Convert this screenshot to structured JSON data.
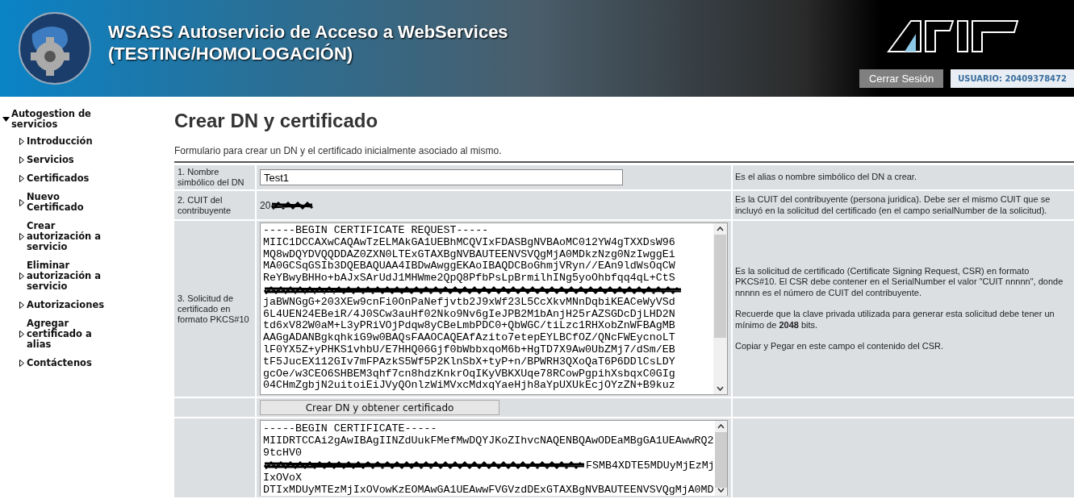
{
  "header": {
    "title_line_1": "WSASS Autoservicio de Acceso a WebServices",
    "title_line_2": "(TESTING/HOMOLOGACIÓN)",
    "logout_button": "Cerrar Sesión",
    "user_badge": "USUARIO: 20409378472"
  },
  "sidebar": {
    "group": {
      "label": "Autogestion de servicios",
      "expanded": true
    },
    "items": [
      {
        "label": "Introducción"
      },
      {
        "label": "Servicios"
      },
      {
        "label": "Certificados"
      },
      {
        "label": "Nuevo Certificado"
      },
      {
        "label": "Crear autorización a servicio"
      },
      {
        "label": "Eliminar autorización a servicio"
      },
      {
        "label": "Autorizaciones"
      },
      {
        "label": "Agregar certificado a alias"
      },
      {
        "label": "Contáctenos"
      }
    ]
  },
  "page": {
    "title": "Crear DN y certificado",
    "description": "Formulario para crear un DN y el certificado inicialmente asociado al mismo."
  },
  "form": {
    "rows": [
      {
        "kind": "input",
        "label": "1. Nombre simbólico del DN",
        "value": "Test1",
        "help": [
          "Es el alias o nombre simbólico del DN a crear."
        ]
      },
      {
        "kind": "redacted",
        "label": "2. CUIT del contribuyente",
        "value": "20",
        "help": [
          "Es la CUIT del contribuyente (persona juridica). Debe ser el mismo CUIT que se incluyó en la solicitud del certificado (en el campo serialNumber de la solicitud)."
        ]
      },
      {
        "kind": "textarea",
        "label": "3. Solicitud de certificado en formato PKCS#10",
        "lines": [
          {
            "kind": "text",
            "text": "-----BEGIN CERTIFICATE REQUEST-----"
          },
          {
            "kind": "text",
            "text": "MIIC1DCCAXwCAQAwTzELMAkGA1UEBhMCQVIxFDASBgNVBAoMC012YW4gTXXDsW96"
          },
          {
            "kind": "text",
            "text": "MQ8wDQYDVQQDDAZ0ZXN0LTExGTAXBgNVBAUTEENVSVQgMjA0MDkzNzg0NzIwggEi"
          },
          {
            "kind": "text",
            "text": "MA0GCSqGSIb3DQEBAQUAA4IBDwAwggEKAoIBAQDCBoGhmjVRyn//EAn9ldWsOqCW"
          },
          {
            "kind": "text",
            "text": "ReYBwyBHHo+bAJxSArUdJ1MHWme2QpQ8PfbPsLpBrmilhINg5yoOhbfqq4qL+CtS"
          },
          {
            "kind": "redacted"
          },
          {
            "kind": "text",
            "text": "jaBWNGgG+203XEw9cnFi0OnPaNefjvtb2J9xWf23L5CcXkvMNnDqbiKEACeWyVSd"
          },
          {
            "kind": "text",
            "text": "6L4UEN24EBeiR/4J0SCw3auHf02Nko9Nv6gIeJPB2M1bAnjH25rAZSGDcDjLHD2N"
          },
          {
            "kind": "text",
            "text": "td6xV82W0aM+L3yPRiVOjPdqw8yCBeLmbPDC0+QbWGC/tiLzc1RHXobZnWFBAgMB"
          },
          {
            "kind": "text",
            "text": "AAGgADANBgkqhkiG9w0BAQsFAAOCAQEAfAzito7etepEYLBCfOZ/QNcFWEycnoLT"
          },
          {
            "kind": "text",
            "text": "lF0YX5Z+yPHKS1vhbU/E7HHQ06Gjf0bWbbxqoM6b+HgTD7X9Aw0UbZMj7/dSm/EB"
          },
          {
            "kind": "text",
            "text": "tF5JucEX112GIv7mFPAzkS5Wf5P2KlnSbX+tyP+n/BPWRH3QXoQaT6P6DDlCsLDY"
          },
          {
            "kind": "text",
            "text": "gcOe/w3CEO6SHBEM3qhf7cn8hdzKnkrOqIKyVBKXUqe78RCowPgpihXsbqxC0GIg"
          },
          {
            "kind": "text",
            "text": "04CHmZgbjN2uitoiEiJVyQOnlzWiMVxcMdxqYaeHjh8aYpUXUkEcjOYzZN+B9kuz"
          }
        ],
        "help": [
          "Es la solicitud de certificado (Certificate Signing Request, CSR) en formato PKCS#10. El CSR debe contener en el SerialNumber el valor \"CUIT nnnnn\", donde nnnnn es el número de CUIT del contribuyente.",
          "Recuerde que la clave privada utilizada para generar esta solicitud debe tener un mínimo de **2048** bits.",
          "Copiar y Pegar en este campo el contenido del CSR."
        ]
      },
      {
        "kind": "button",
        "label_button": "Crear DN y obtener certificado"
      },
      {
        "kind": "output",
        "lines": [
          {
            "kind": "text",
            "text": "-----BEGIN CERTIFICATE-----"
          },
          {
            "kind": "text",
            "text": "MIIDRTCCAi2gAwIBAgIINZdUukFMefMwDQYJKoZIhvcNAQENBQAwODEaMBgGA1UEAwwRQ2"
          },
          {
            "kind": "text",
            "text": "9tcHV0"
          },
          {
            "kind": "redacted",
            "text": "FSMB4XDTE5MDUyMjEzMj"
          },
          {
            "kind": "text",
            "text": "IxOVoX"
          },
          {
            "kind": "text",
            "text": "DTIxMDUyMTEzMjIxOVowKzEOMAwGA1UEAwwFVGVzdDExGTAXBgNVBAUTEENVSVQgMjA0MD"
          }
        ]
      }
    ]
  }
}
